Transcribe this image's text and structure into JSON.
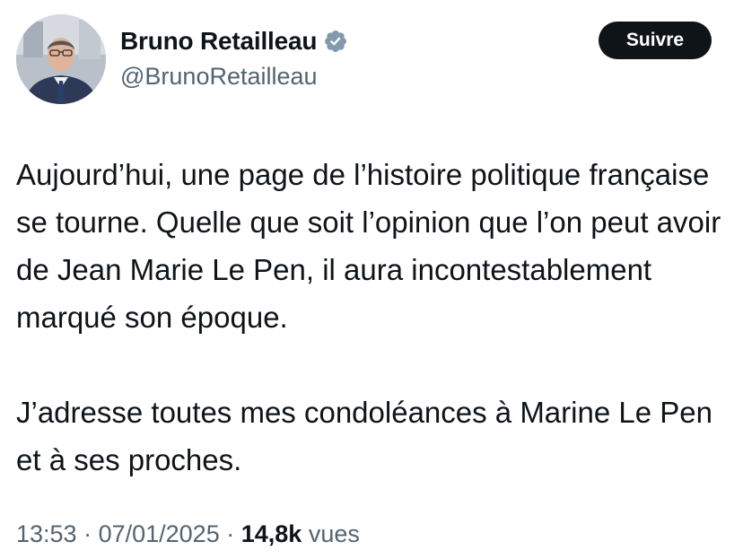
{
  "author": {
    "display_name": "Bruno Retailleau",
    "handle": "@BrunoRetailleau",
    "verified": true
  },
  "follow_button": {
    "label": "Suivre"
  },
  "tweet": {
    "paragraphs": [
      "Aujourd’hui, une page de l’histoire politique française se tourne. Quelle que soit l’opinion que l’on peut avoir de Jean Marie Le Pen, il aura incontestablement marqué son époque.",
      "J’adresse toutes mes condoléances à Marine Le Pen et à ses proches."
    ]
  },
  "meta": {
    "time": "13:53",
    "separator": " · ",
    "date": "07/01/2025",
    "views_count": "14,8k",
    "views_label": "vues"
  },
  "icons": {
    "verified": "verified-badge-icon",
    "avatar": "profile-photo"
  },
  "colors": {
    "text_primary": "#0f1419",
    "text_secondary": "#536471",
    "button_bg": "#0f1419",
    "verified_badge": "#829aab"
  }
}
